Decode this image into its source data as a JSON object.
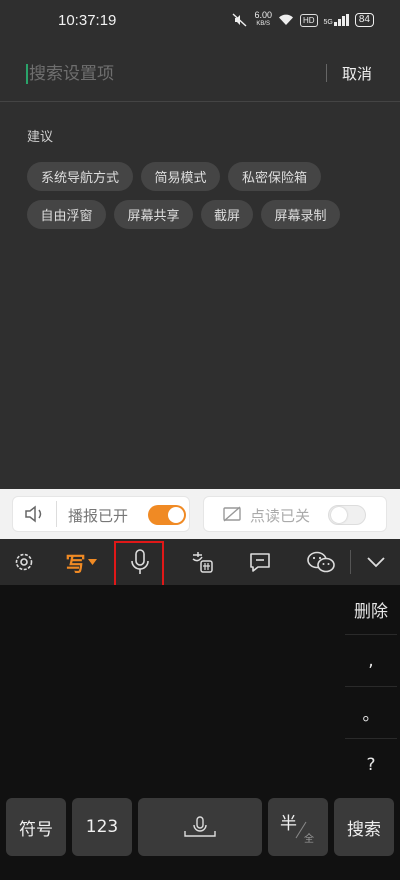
{
  "status_bar": {
    "time": "10:37:19",
    "net_speed_value": "6.00",
    "net_speed_unit": "KB/S",
    "hd_label": "HD",
    "signal_label": "5G",
    "battery": "84"
  },
  "search": {
    "placeholder": "搜索设置项",
    "value": "",
    "cancel_label": "取消"
  },
  "suggestions": {
    "title": "建议",
    "chips": [
      "系统导航方式",
      "简易模式",
      "私密保险箱",
      "自由浮窗",
      "屏幕共享",
      "截屏",
      "屏幕录制"
    ]
  },
  "accessibility_bar": {
    "broadcast_label": "播报已开",
    "broadcast_on": true,
    "point_read_label": "点读已关",
    "point_read_on": false
  },
  "ime_toolbar": {
    "write_label": "写",
    "items": [
      "settings-icon",
      "handwrite",
      "microphone-icon",
      "emoji-face-icon",
      "comment-icon",
      "wechat-icon",
      "collapse-chevron-icon"
    ],
    "accent_color": "#f08a24"
  },
  "keyboard": {
    "delete_label": "删除",
    "punct": [
      ",",
      "。",
      "?"
    ],
    "symbols_label": "符号",
    "numbers_label": "123",
    "halfwidth_label": "半",
    "fullwidth_label": "全",
    "search_label": "搜索"
  },
  "colors": {
    "toggle_on": "#f08a24",
    "highlight": "#e01818",
    "cursor": "#2aa36a"
  }
}
